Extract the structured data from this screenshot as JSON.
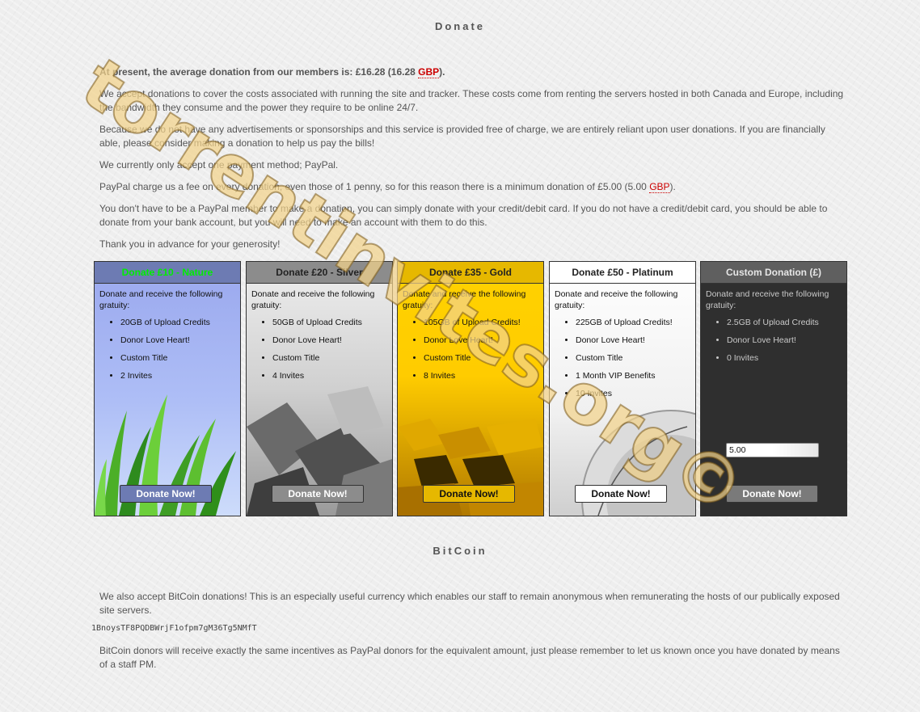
{
  "donate": {
    "heading": "Donate",
    "average_prefix": "At present, the average donation from our members is: £16.28 (16.28 ",
    "average_currency": "GBP",
    "average_suffix": ").",
    "p1": "We accept donations to cover the costs associated with running the site and tracker. These costs come from renting the servers hosted in both Canada and Europe, including the bandwidth they consume and the power they require to be online 24/7.",
    "p2": "Because we do not have any advertisements or sponsorships and this service is provided free of charge, we are entirely reliant upon user donations. If you are financially able, please consider making a donation to help us pay the bills!",
    "p3": "We currently only accept one payment method; PayPal.",
    "p4_prefix": "PayPal charge us a fee on every donation, even those of 1 penny, so for this reason there is a minimum donation of £5.00 (5.00 ",
    "p4_currency": "GBP",
    "p4_suffix": ").",
    "p5": "You don't have to be a PayPal member to make a donation, you can simply donate with your credit/debit card. If you do not have a credit/debit card, you should be able to donate from your bank account, but you will need to make an account with them to do this.",
    "p6": "Thank you in advance for your generosity!"
  },
  "tiers": [
    {
      "title": "Donate £10 - Nature",
      "desc": "Donate and receive the following gratuity:",
      "perks": [
        "20GB of Upload Credits",
        "Donor Love Heart!",
        "Custom Title",
        "2 Invites"
      ],
      "button": "Donate Now!"
    },
    {
      "title": "Donate £20 - Silver",
      "desc": "Donate and receive the following gratuity:",
      "perks": [
        "50GB of Upload Credits",
        "Donor Love Heart!",
        "Custom Title",
        "4 Invites"
      ],
      "button": "Donate Now!"
    },
    {
      "title": "Donate £35 - Gold",
      "desc": "Donate and receive the following gratuity:",
      "perks": [
        "105GB of Upload Credits!",
        "Donor Love Heart!",
        "Custom Title",
        "8 Invites"
      ],
      "button": "Donate Now!"
    },
    {
      "title": "Donate £50 - Platinum",
      "desc": "Donate and receive the following gratuity:",
      "perks": [
        "225GB of Upload Credits!",
        "Donor Love Heart!",
        "Custom Title",
        "1 Month VIP Benefits",
        "10 Invites"
      ],
      "button": "Donate Now!"
    },
    {
      "title": "Custom Donation (£)",
      "desc": "Donate and receive the following gratuity:",
      "perks": [
        "2.5GB of Upload Credits",
        "Donor Love Heart!",
        "0 Invites"
      ],
      "button": "Donate Now!",
      "amount": "5.00"
    }
  ],
  "bitcoin": {
    "heading": "BitCoin",
    "p1": "We also accept BitCoin donations! This is an especially useful currency which enables our staff to remain anonymous when remunerating the hosts of our publically exposed site servers.",
    "address": "1BnoysTF8PQDBWrjF1ofpm7gM36Tg5NMfT",
    "p2": "BitCoin donors will receive exactly the same incentives as PayPal donors for the equivalent amount, just please remember to let us known once you have donated by means of a staff PM."
  },
  "watermark": "torrentinvites.org©"
}
